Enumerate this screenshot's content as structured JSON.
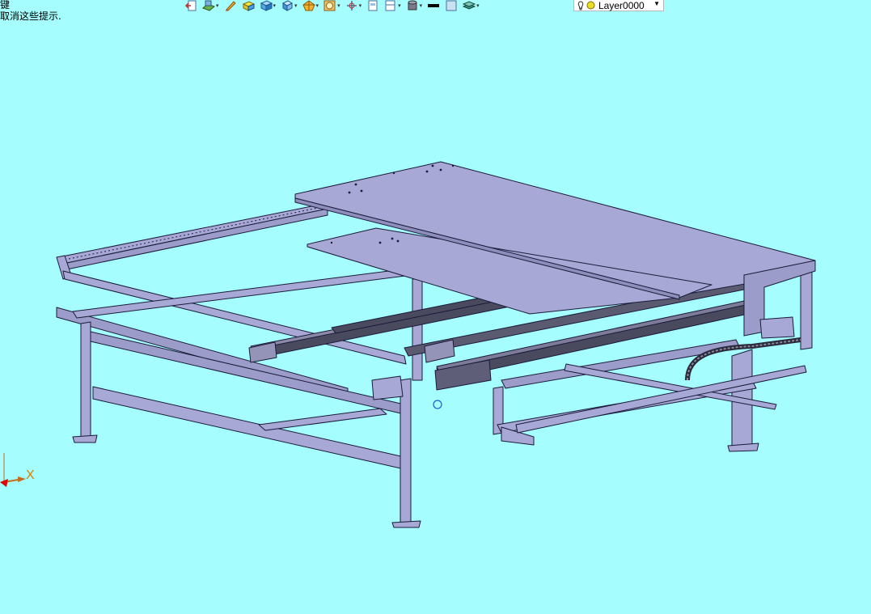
{
  "hints": {
    "line1": "键",
    "line2": "取消这些提示."
  },
  "toolbar": {
    "buttons": [
      {
        "icon": "exit-sketch-icon",
        "dropdown": false
      },
      {
        "icon": "sketch-plane-icon",
        "dropdown": true
      },
      {
        "icon": "pencil-icon",
        "dropdown": false
      },
      {
        "icon": "extrude-icon",
        "dropdown": false
      },
      {
        "icon": "solid-cube-icon",
        "dropdown": true
      },
      {
        "icon": "view-cube-icon",
        "dropdown": true
      },
      {
        "icon": "render-style-icon",
        "dropdown": true
      },
      {
        "icon": "lens-icon",
        "dropdown": true
      },
      {
        "icon": "move-axis-icon",
        "dropdown": true
      },
      {
        "icon": "page-icon",
        "dropdown": false
      },
      {
        "icon": "layout-icon",
        "dropdown": true
      },
      {
        "icon": "cylinder-icon",
        "dropdown": true
      },
      {
        "icon": "line-color-icon",
        "dropdown": false
      },
      {
        "icon": "fill-swatch-icon",
        "dropdown": false
      },
      {
        "icon": "layer-stack-icon",
        "dropdown": true
      }
    ]
  },
  "layer": {
    "name": "Layer0000"
  },
  "axis": {
    "x_label": "X"
  },
  "colors": {
    "background": "#a6fdfd",
    "model_face": "#a8a8d6",
    "model_edge": "#1a1a3a",
    "axis_label": "#d4820a"
  }
}
